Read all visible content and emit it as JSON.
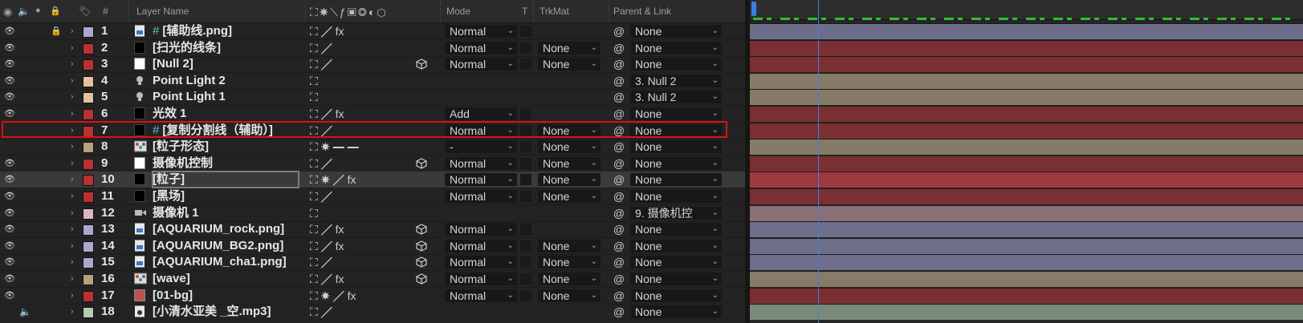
{
  "header": {
    "layer_name": "Layer Name",
    "num": "#",
    "mode": "Mode",
    "t": "T",
    "trkmat": "TrkMat",
    "parent": "Parent & Link"
  },
  "colors": {
    "label_lavender": "#a9a9d2",
    "label_red": "#b83232",
    "label_peach": "#e7c09c",
    "label_tan": "#b8a07a",
    "label_pink": "#e0b4c0",
    "label_sage": "#b7ccb1",
    "bar_lavender": "#6e6e8a",
    "bar_red": "#7a2f33",
    "bar_tan": "#857b68",
    "bar_pink": "#8a6f77",
    "bar_sage": "#7a8a78",
    "highlight_box": "#e01010",
    "playhead": "#3b7fe0"
  },
  "layers": [
    {
      "num": "1",
      "name": "[辅助线.png]",
      "label": "#a9a9d2",
      "icon": "image-file",
      "prefix": "#",
      "switches": "⛶ ╱ fx",
      "mode": "Normal",
      "trkmat": "",
      "parent": "None",
      "bar": "#6e6e8a",
      "lock": true
    },
    {
      "num": "2",
      "name": "[扫光的线条]",
      "label": "#b83232",
      "icon": "solid-black",
      "prefix": "",
      "switches": "⛶ ╱",
      "mode": "Normal",
      "trkmat": "None",
      "parent": "None",
      "bar": "#7a2f33"
    },
    {
      "num": "3",
      "name": "[Null 2]",
      "label": "#b83232",
      "icon": "solid-white",
      "prefix": "",
      "switches": "⛶ ╱",
      "mode": "Normal",
      "trkmat": "None",
      "parent": "None",
      "bar": "#7a2f33",
      "cube": true
    },
    {
      "num": "4",
      "name": "Point Light 2",
      "label": "#e7c09c",
      "icon": "light",
      "prefix": "",
      "switches": "⛶",
      "mode": "",
      "trkmat": "",
      "parent": "3. Null 2",
      "bar": "#857b68"
    },
    {
      "num": "5",
      "name": "Point Light 1",
      "label": "#e7c09c",
      "icon": "light",
      "prefix": "",
      "switches": "⛶",
      "mode": "",
      "trkmat": "",
      "parent": "3. Null 2",
      "bar": "#857b68"
    },
    {
      "num": "6",
      "name": "光效 1",
      "label": "#b83232",
      "icon": "solid-black",
      "prefix": "",
      "switches": "⛶ ╱ fx",
      "mode": "Add",
      "trkmat": "",
      "parent": "None",
      "bar": "#7a2f33"
    },
    {
      "num": "7",
      "name": "[复制分割线（辅助）]",
      "label": "#b83232",
      "icon": "solid-black",
      "prefix": "#",
      "switches": "⛶ ╱",
      "mode": "Normal",
      "trkmat": "None",
      "parent": "None",
      "bar": "#7a2f33",
      "noeye": true
    },
    {
      "num": "8",
      "name": "[粒子形态]",
      "label": "#b8a07a",
      "icon": "comp",
      "prefix": "",
      "switches": "⛶ ☀ ━   ━",
      "mode": "-",
      "trkmat": "None",
      "parent": "None",
      "bar": "#857b68",
      "noeye": true
    },
    {
      "num": "9",
      "name": "摄像机控制",
      "label": "#b83232",
      "icon": "solid-white",
      "prefix": "",
      "switches": "⛶ ╱",
      "mode": "Normal",
      "trkmat": "None",
      "parent": "None",
      "bar": "#7a2f33",
      "cube": true
    },
    {
      "num": "10",
      "name": "[粒子]",
      "label": "#b83232",
      "icon": "solid-black",
      "prefix": "",
      "switches": "⛶ ☀ ╱ fx",
      "mode": "Normal",
      "trkmat": "None",
      "parent": "None",
      "bar": "#9c3a3f",
      "selected": true
    },
    {
      "num": "11",
      "name": "[黑场]",
      "label": "#b83232",
      "icon": "solid-black",
      "prefix": "",
      "switches": "⛶ ╱",
      "mode": "Normal",
      "trkmat": "None",
      "parent": "None",
      "bar": "#7a2f33"
    },
    {
      "num": "12",
      "name": "摄像机 1",
      "label": "#e0b4c0",
      "icon": "camera",
      "prefix": "",
      "switches": "⛶",
      "mode": "",
      "trkmat": "",
      "parent": "9. 摄像机控",
      "bar": "#8a6f77"
    },
    {
      "num": "13",
      "name": "[AQUARIUM_rock.png]",
      "label": "#a9a9d2",
      "icon": "image-file",
      "prefix": "",
      "switches": "⛶ ╱ fx",
      "mode": "Normal",
      "trkmat": "",
      "parent": "None",
      "bar": "#6e6e8a",
      "cube": true
    },
    {
      "num": "14",
      "name": "[AQUARIUM_BG2.png]",
      "label": "#a9a9d2",
      "icon": "image-file",
      "prefix": "",
      "switches": "⛶ ╱ fx",
      "mode": "Normal",
      "trkmat": "None",
      "parent": "None",
      "bar": "#6e6e8a",
      "cube": true
    },
    {
      "num": "15",
      "name": "[AQUARIUM_cha1.png]",
      "label": "#a9a9d2",
      "icon": "image-file",
      "prefix": "",
      "switches": "⛶ ╱",
      "mode": "Normal",
      "trkmat": "None",
      "parent": "None",
      "bar": "#6e6e8a",
      "cube": true
    },
    {
      "num": "16",
      "name": "[wave]",
      "label": "#b8a07a",
      "icon": "comp",
      "prefix": "",
      "switches": "⛶ ╱ fx",
      "mode": "Normal",
      "trkmat": "None",
      "parent": "None",
      "bar": "#857b68",
      "cube": true
    },
    {
      "num": "17",
      "name": "[01-bg]",
      "label": "#b83232",
      "icon": "solid-red",
      "prefix": "",
      "switches": "⛶ ☀ ╱ fx",
      "mode": "Normal",
      "trkmat": "None",
      "parent": "None",
      "bar": "#7a2f33"
    },
    {
      "num": "18",
      "name": "[小清水亚美 _空.mp3]",
      "label": "#b7ccb1",
      "icon": "audio-file",
      "prefix": "",
      "switches": "⛶ ╱",
      "mode": "",
      "trkmat": "",
      "parent": "None",
      "bar": "#7a8a78",
      "audio": true,
      "noeye": true
    }
  ]
}
